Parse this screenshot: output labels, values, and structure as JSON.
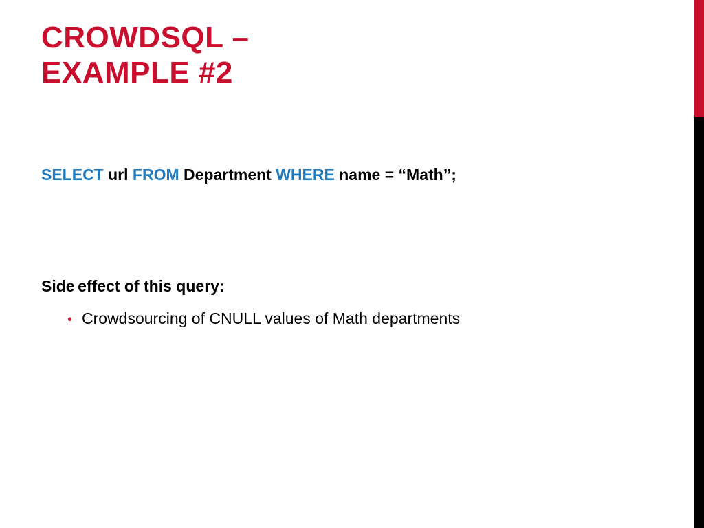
{
  "title_line1": "CROWDSQL –",
  "title_line2": "EXAMPLE #2",
  "sql": {
    "kw_select": "SELECT",
    "col": " url ",
    "kw_from": "FROM",
    "table": " Department ",
    "kw_where": "WHERE",
    "predicate": " name = “Math”;"
  },
  "side_label": "Side effect of this query:",
  "bullet": "Crowdsourcing of CNULL values of Math departments"
}
